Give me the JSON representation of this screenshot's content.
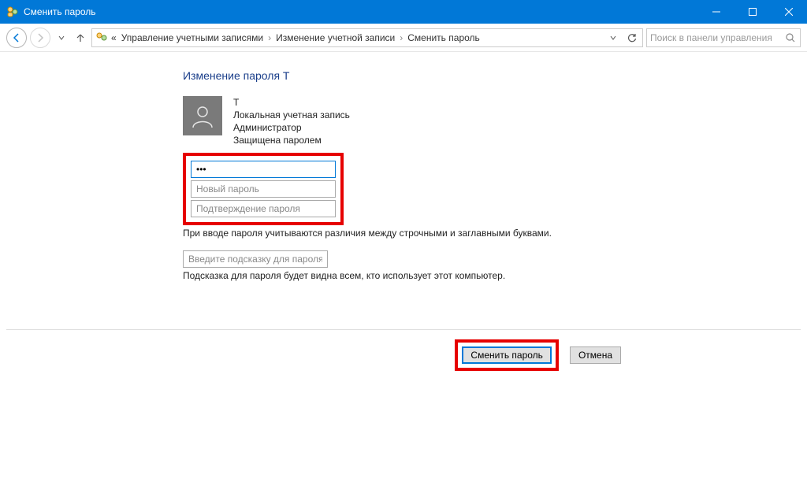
{
  "window": {
    "title": "Сменить пароль"
  },
  "breadcrumb": {
    "prefix": "«",
    "seg1": "Управление учетными записями",
    "seg2": "Изменение учетной записи",
    "seg3": "Сменить пароль"
  },
  "search": {
    "placeholder": "Поиск в панели управления"
  },
  "page": {
    "title": "Изменение пароля T"
  },
  "account": {
    "name": "T",
    "type": "Локальная учетная запись",
    "role": "Администратор",
    "protection": "Защищена паролем"
  },
  "inputs": {
    "current_value": "•••",
    "new_placeholder": "Новый пароль",
    "confirm_placeholder": "Подтверждение пароля",
    "hint_placeholder": "Введите подсказку для пароля"
  },
  "hints": {
    "case_sensitive": "При вводе пароля учитываются различия между строчными и заглавными буквами.",
    "visible_to_all": "Подсказка для пароля будет видна всем, кто использует этот компьютер."
  },
  "buttons": {
    "submit": "Сменить пароль",
    "cancel": "Отмена"
  }
}
